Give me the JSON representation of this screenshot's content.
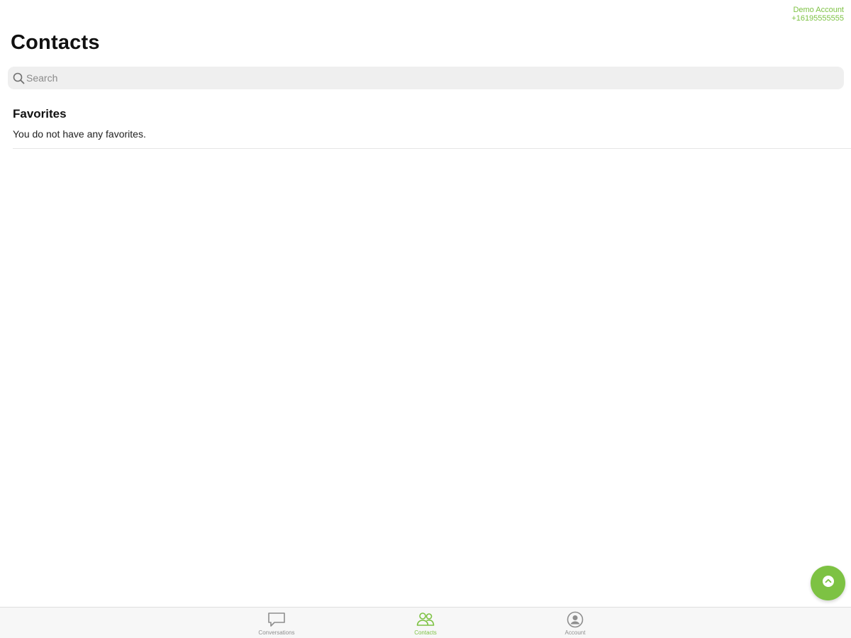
{
  "account": {
    "name": "Demo Account",
    "number": "+16195555555"
  },
  "header": {
    "title": "Contacts"
  },
  "search": {
    "placeholder": "Search",
    "icon": "search-icon"
  },
  "favorites": {
    "title": "Favorites",
    "empty_message": "You do not have any favorites."
  },
  "fab": {
    "icon": "compose-icon"
  },
  "tabs": [
    {
      "label": "Conversations",
      "icon": "chat-bubble-icon",
      "active": false
    },
    {
      "label": "Contacts",
      "icon": "people-icon",
      "active": true
    },
    {
      "label": "Account",
      "icon": "user-circle-icon",
      "active": false
    }
  ],
  "colors": {
    "accent": "#7dc243",
    "tab_inactive": "#8e8e8e",
    "search_bg": "#efefef"
  }
}
